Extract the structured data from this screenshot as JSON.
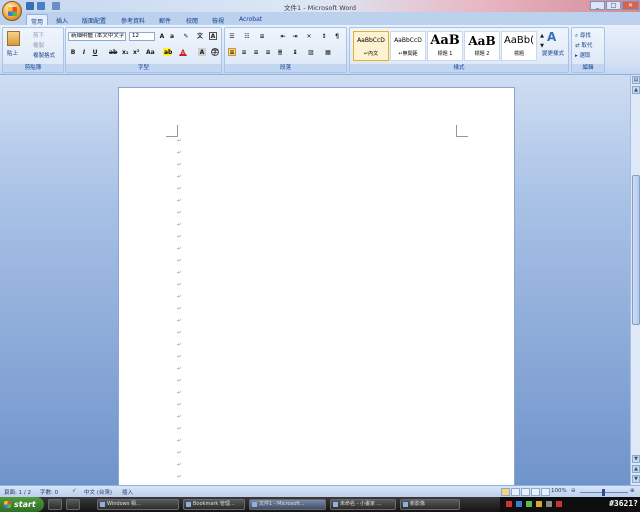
{
  "window": {
    "title": "文件1 - Microsoft Word"
  },
  "tabs": [
    "常用",
    "插入",
    "版面配置",
    "參考資料",
    "郵件",
    "校閱",
    "檢視",
    "Acrobat"
  ],
  "ribbon": {
    "clipboard": {
      "label": "剪貼簿",
      "paste": "貼上",
      "cut": "剪下",
      "copy": "複製",
      "format_painter": "複製格式"
    },
    "font": {
      "label": "字型",
      "font_name": "新細明體 (本文中文字)",
      "font_size": "12"
    },
    "paragraph": {
      "label": "段落"
    },
    "styles": {
      "label": "樣式",
      "items": [
        {
          "preview": "AaBbCcD",
          "name": "↵內文"
        },
        {
          "preview": "AaBbCcD",
          "name": "↵無間距"
        },
        {
          "preview": "AaB",
          "name": "標題 1"
        },
        {
          "preview": "AaB",
          "name": "標題 2"
        },
        {
          "preview": "AaBb(",
          "name": "標題"
        }
      ],
      "change_styles": "變更樣式"
    },
    "editing": {
      "label": "編輯",
      "find": "尋找",
      "replace": "取代",
      "select": "選取"
    }
  },
  "document": {
    "paragraph_mark": "↵",
    "line_count": 31
  },
  "status": {
    "page": "頁面: 1 / 2",
    "words": "字數: 0",
    "language": "中文 (台灣)",
    "mode": "插入",
    "zoom": "100%"
  },
  "taskbar": {
    "start": "start",
    "tasks": [
      "Windows 相...",
      "Bookmark 管理...",
      "文件1 - Microsoft...",
      "未命名 - 小畫家 ...",
      "新影像"
    ],
    "clock": "#3621?"
  }
}
